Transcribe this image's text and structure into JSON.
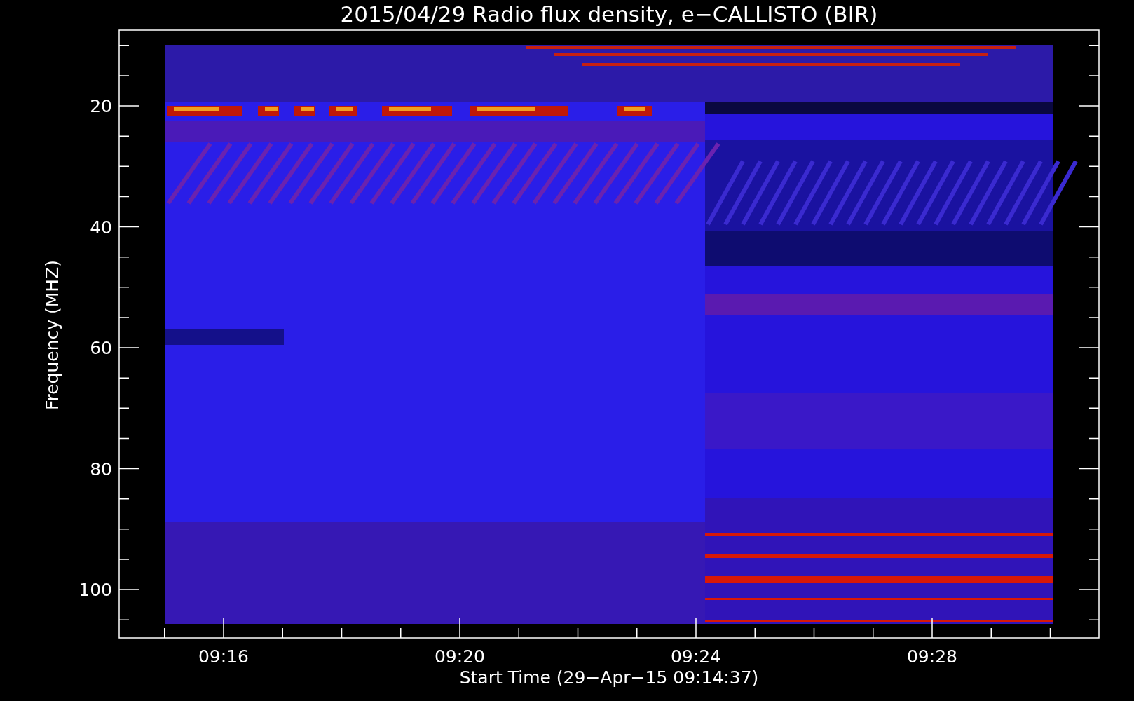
{
  "plot": {
    "title": "2015/04/29  Radio flux density, e−CALLISTO (BIR)",
    "ylabel": "Frequency (MHZ)",
    "xlabel": "Start Time (29−Apr−15 09:14:37)",
    "yticks": [
      "20",
      "40",
      "60",
      "80",
      "100"
    ],
    "xticks": [
      "09:16",
      "09:20",
      "09:24",
      "09:28"
    ]
  }
}
